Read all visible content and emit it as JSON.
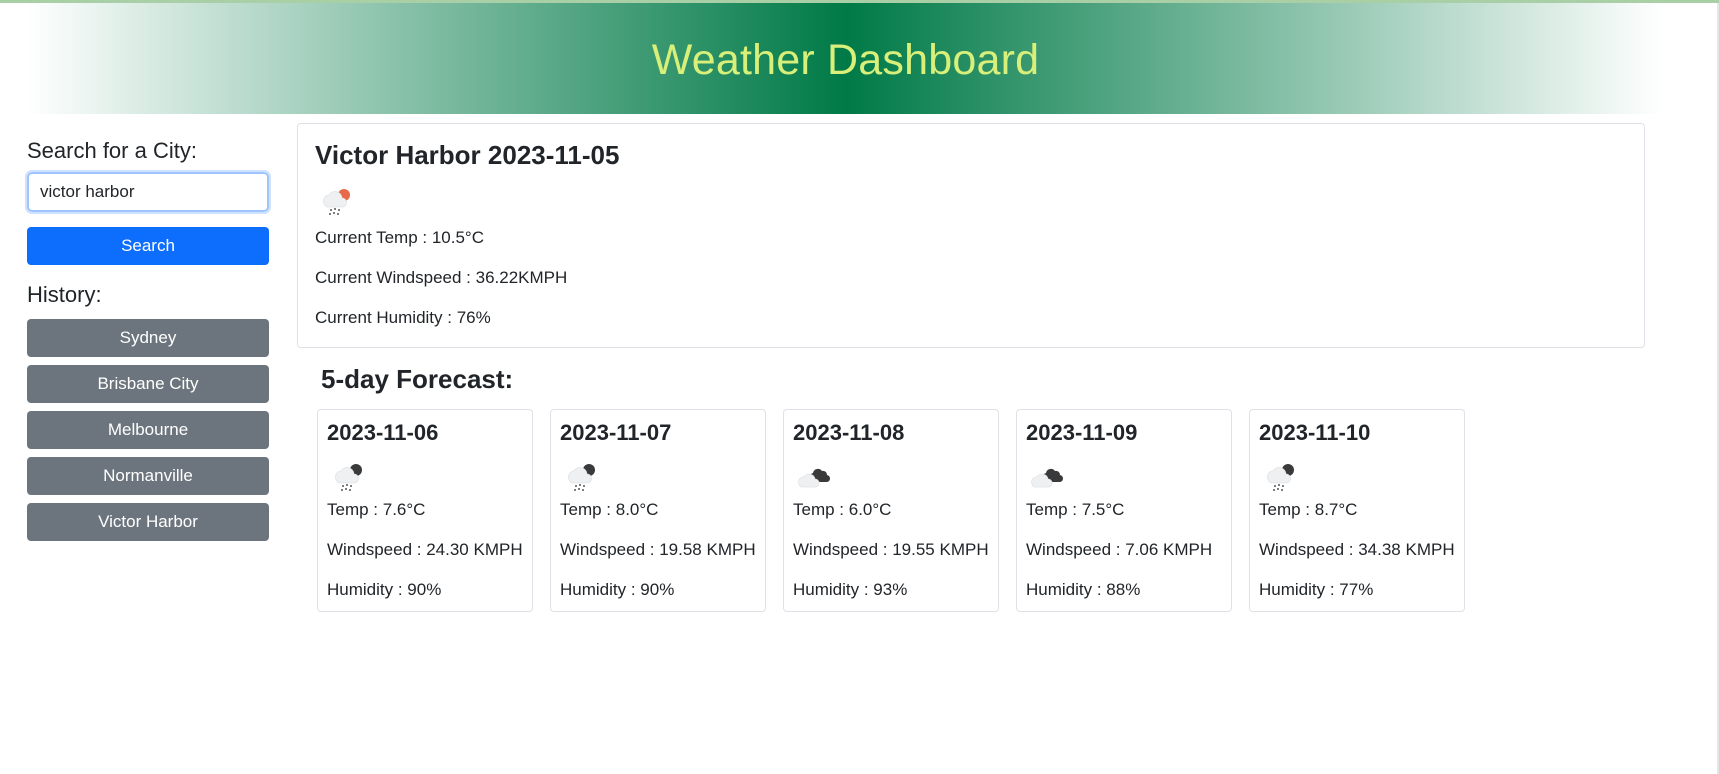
{
  "header": {
    "title": "Weather Dashboard"
  },
  "sidebar": {
    "search_label": "Search for a City:",
    "search_value": "victor harbor",
    "search_button": "Search",
    "history_label": "History:",
    "history": [
      "Sydney",
      "Brisbane City",
      "Melbourne",
      "Normanville",
      "Victor Harbor"
    ]
  },
  "current": {
    "title": "Victor Harbor 2023-11-05",
    "icon": "rain-sun-icon",
    "temp": "Current Temp : 10.5°C",
    "wind": "Current Windspeed : 36.22KMPH",
    "humidity": "Current Humidity : 76%"
  },
  "forecast": {
    "title": "5-day Forecast:",
    "days": [
      {
        "date": "2023-11-06",
        "icon": "rain-cloud-icon",
        "temp": "Temp : 7.6°C",
        "wind": "Windspeed : 24.30 KMPH",
        "humidity": "Humidity : 90%"
      },
      {
        "date": "2023-11-07",
        "icon": "rain-cloud-icon",
        "temp": "Temp : 8.0°C",
        "wind": "Windspeed : 19.58 KMPH",
        "humidity": "Humidity : 90%"
      },
      {
        "date": "2023-11-08",
        "icon": "broken-clouds-icon",
        "temp": "Temp : 6.0°C",
        "wind": "Windspeed : 19.55 KMPH",
        "humidity": "Humidity : 93%"
      },
      {
        "date": "2023-11-09",
        "icon": "broken-clouds-icon",
        "temp": "Temp : 7.5°C",
        "wind": "Windspeed : 7.06 KMPH",
        "humidity": "Humidity : 88%"
      },
      {
        "date": "2023-11-10",
        "icon": "rain-cloud-icon",
        "temp": "Temp : 8.7°C",
        "wind": "Windspeed : 34.38 KMPH",
        "humidity": "Humidity : 77%"
      }
    ]
  },
  "colors": {
    "header_green": "#007a47",
    "title_text": "#d8ef7a",
    "search_button": "#0d6efd",
    "history_button": "#6c757d"
  }
}
